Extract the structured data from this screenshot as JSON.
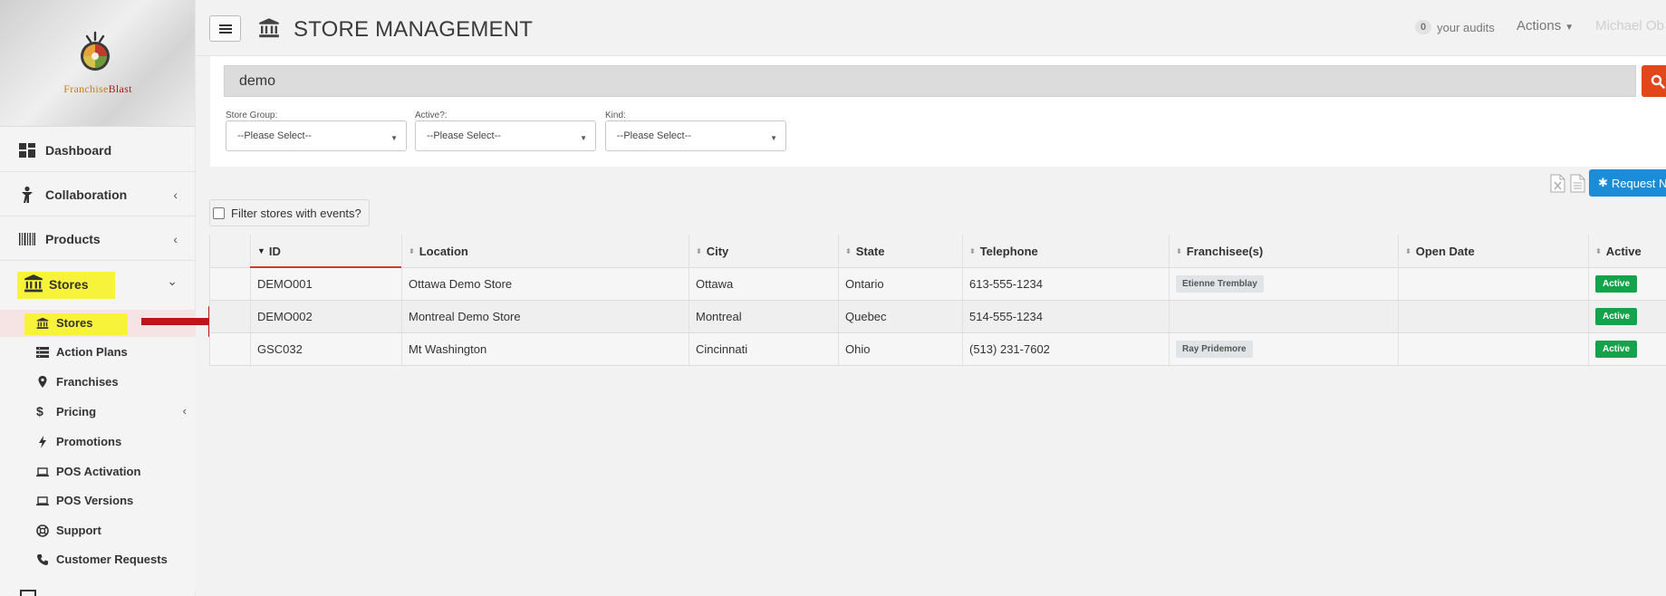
{
  "brand": {
    "name_first": "Franchise",
    "name_second": "Blast"
  },
  "header": {
    "title": "STORE MANAGEMENT",
    "audits_count": "0",
    "audits_label": "your audits",
    "actions_label": "Actions",
    "user_name": "Michael Ob"
  },
  "sidebar": {
    "main_items": [
      {
        "label": "Dashboard",
        "icon": "dashboard-icon"
      },
      {
        "label": "Collaboration",
        "icon": "person-icon",
        "chevron": "‹"
      },
      {
        "label": "Products",
        "icon": "barcode-icon",
        "chevron": "‹"
      },
      {
        "label": "Stores",
        "icon": "bank-icon",
        "chevron": "⌄"
      }
    ],
    "sub_items": [
      {
        "label": "Stores",
        "icon": "bank-icon"
      },
      {
        "label": "Action Plans",
        "icon": "list-icon"
      },
      {
        "label": "Franchises",
        "icon": "map-marker-icon"
      },
      {
        "label": "Pricing",
        "icon": "dollar-icon",
        "chevron": "‹"
      },
      {
        "label": "Promotions",
        "icon": "bolt-icon"
      },
      {
        "label": "POS Activation",
        "icon": "laptop-icon"
      },
      {
        "label": "POS Versions",
        "icon": "laptop-icon"
      },
      {
        "label": "Support",
        "icon": "lifebuoy-icon"
      },
      {
        "label": "Customer Requests",
        "icon": "phone-icon"
      }
    ]
  },
  "search": {
    "value": "demo"
  },
  "filters": [
    {
      "label": "Store Group:",
      "value": "--Please Select--"
    },
    {
      "label": "Active?:",
      "value": "--Please Select--"
    },
    {
      "label": "Kind:",
      "value": "--Please Select--"
    }
  ],
  "toolbar": {
    "request_label": "Request Ne"
  },
  "filter_events_label": "Filter stores with events?",
  "table": {
    "columns": [
      "ID",
      "Location",
      "City",
      "State",
      "Telephone",
      "Franchisee(s)",
      "Open Date",
      "Active"
    ],
    "rows": [
      {
        "id": "DEMO001",
        "location": "Ottawa Demo Store",
        "city": "Ottawa",
        "state": "Ontario",
        "telephone": "613-555-1234",
        "franchisee": "Etienne Tremblay",
        "open_date": "",
        "active": "Active"
      },
      {
        "id": "DEMO002",
        "location": "Montreal Demo Store",
        "city": "Montreal",
        "state": "Quebec",
        "telephone": "514-555-1234",
        "franchisee": "",
        "open_date": "",
        "active": "Active"
      },
      {
        "id": "GSC032",
        "location": "Mt Washington",
        "city": "Cincinnati",
        "state": "Ohio",
        "telephone": "(513) 231-7602",
        "franchisee": "Ray Pridemore",
        "open_date": "",
        "active": "Active"
      }
    ]
  },
  "colors": {
    "accent_search": "#e2461b",
    "active_green": "#14a34a",
    "request_blue": "#1a8cd8",
    "highlight_yellow": "#f7f23a",
    "annotation_arrow": "#c0141b"
  }
}
